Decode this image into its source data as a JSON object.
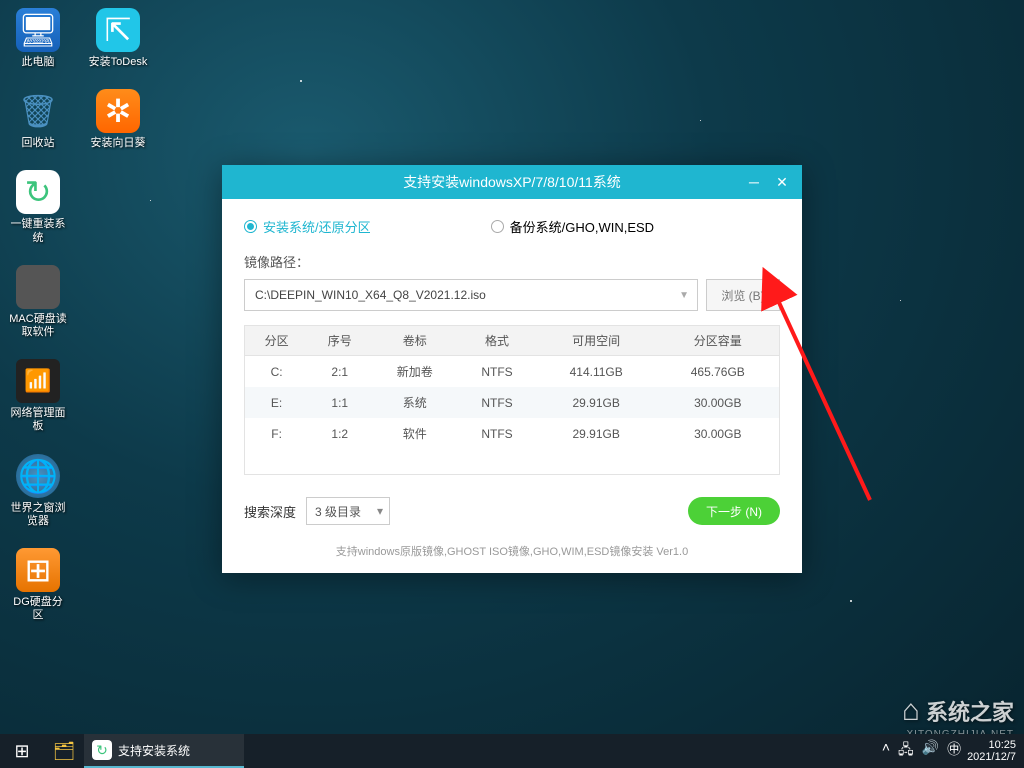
{
  "desktop": {
    "icons": [
      {
        "label": "此电脑",
        "glyph": "🖥",
        "cls": "monitor",
        "name": "this-pc"
      },
      {
        "label": "安装ToDesk",
        "glyph": "⇱",
        "cls": "todesk",
        "name": "todesk"
      },
      {
        "label": "回收站",
        "glyph": "🗑",
        "cls": "trash",
        "name": "recycle-bin"
      },
      {
        "label": "安装向日葵",
        "glyph": "✲",
        "cls": "sunflower",
        "name": "sunflower"
      },
      {
        "label": "一键重装系统",
        "glyph": "↻",
        "cls": "reinstall",
        "name": "one-click-reinstall"
      },
      {
        "label": "MAC硬盘读取软件",
        "glyph": "",
        "cls": "mac",
        "name": "mac-disk"
      },
      {
        "label": "网络管理面板",
        "glyph": "📶",
        "cls": "net",
        "name": "network-panel"
      },
      {
        "label": "世界之窗浏览器",
        "glyph": "🌐",
        "cls": "world",
        "name": "world-browser"
      },
      {
        "label": "DG硬盘分区",
        "glyph": "⊞",
        "cls": "dg",
        "name": "dg-partition"
      }
    ]
  },
  "installer": {
    "title": "支持安装windowsXP/7/8/10/11系统",
    "radio_install": "安装系统/还原分区",
    "radio_backup": "备份系统/GHO,WIN,ESD",
    "image_path_label": "镜像路径：",
    "image_path_value": "C:\\DEEPIN_WIN10_X64_Q8_V2021.12.iso",
    "browse_btn": "浏览 (B)",
    "columns": [
      "分区",
      "序号",
      "卷标",
      "格式",
      "可用空间",
      "分区容量"
    ],
    "rows": [
      {
        "drive": "C:",
        "idx": "2:1",
        "label": "新加卷",
        "fmt": "NTFS",
        "free": "414.11GB",
        "cap": "465.76GB"
      },
      {
        "drive": "E:",
        "idx": "1:1",
        "label": "系统",
        "fmt": "NTFS",
        "free": "29.91GB",
        "cap": "30.00GB"
      },
      {
        "drive": "F:",
        "idx": "1:2",
        "label": "软件",
        "fmt": "NTFS",
        "free": "29.91GB",
        "cap": "30.00GB"
      }
    ],
    "depth_label": "搜索深度",
    "depth_value": "3 级目录",
    "next_btn": "下一步 (N)",
    "footer": "支持windows原版镜像,GHOST ISO镜像,GHO,WIM,ESD镜像安装 Ver1.0"
  },
  "taskbar": {
    "active_app": "支持安装系统",
    "time": "10:25",
    "date": "2021/12/7"
  },
  "watermark": {
    "text": "系统之家",
    "sub": "XITONGZHIJIA.NET"
  }
}
